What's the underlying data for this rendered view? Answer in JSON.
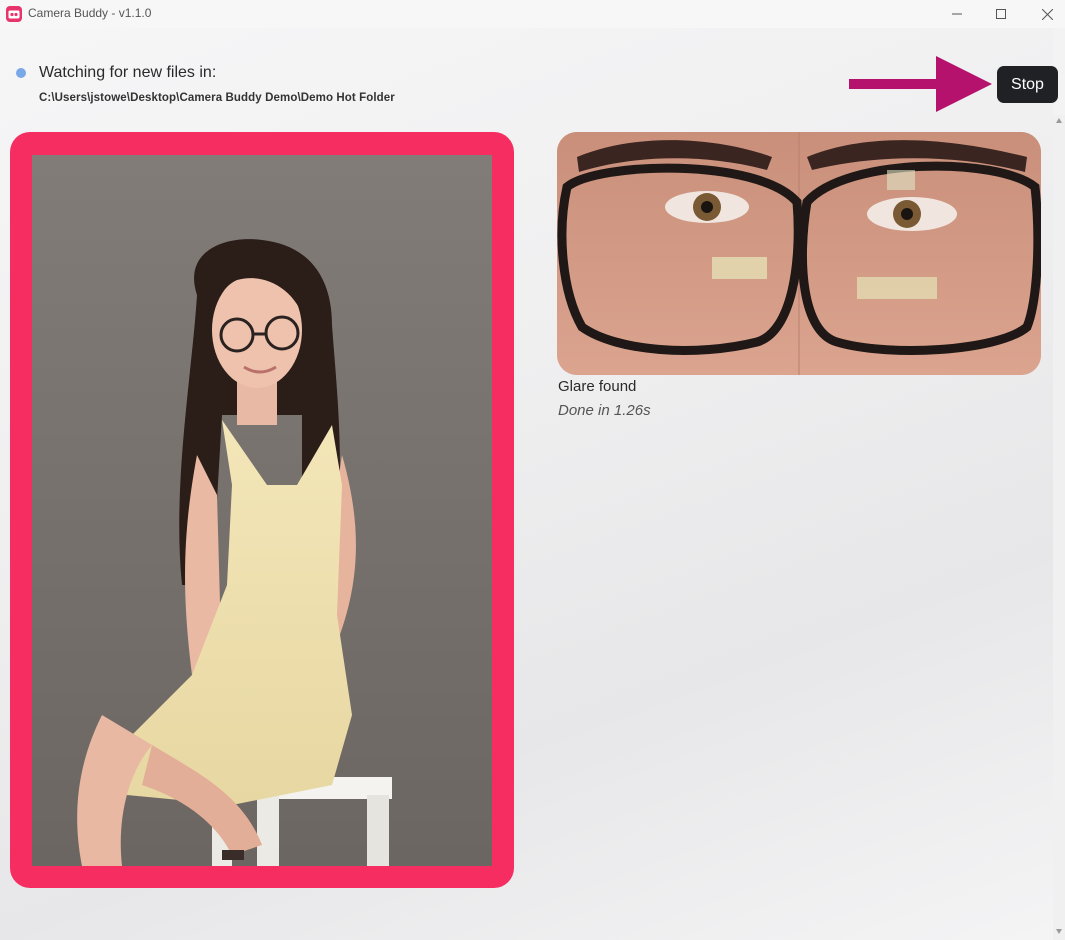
{
  "window": {
    "title": "Camera Buddy - v1.1.0",
    "minimize_icon": "minimize-icon",
    "maximize_icon": "maximize-icon",
    "close_icon": "close-icon"
  },
  "watcher": {
    "label": "Watching for new files in:",
    "path": "C:\\Users\\jstowe\\Desktop\\Camera Buddy Demo\\Demo Hot Folder",
    "status_color": "#7aa7e8"
  },
  "toolbar": {
    "stop_label": "Stop"
  },
  "result": {
    "status": "Glare found",
    "duration": "Done in 1.26s",
    "frame_color": "#f52d60"
  },
  "annotation": {
    "arrow_color": "#b5126e"
  }
}
